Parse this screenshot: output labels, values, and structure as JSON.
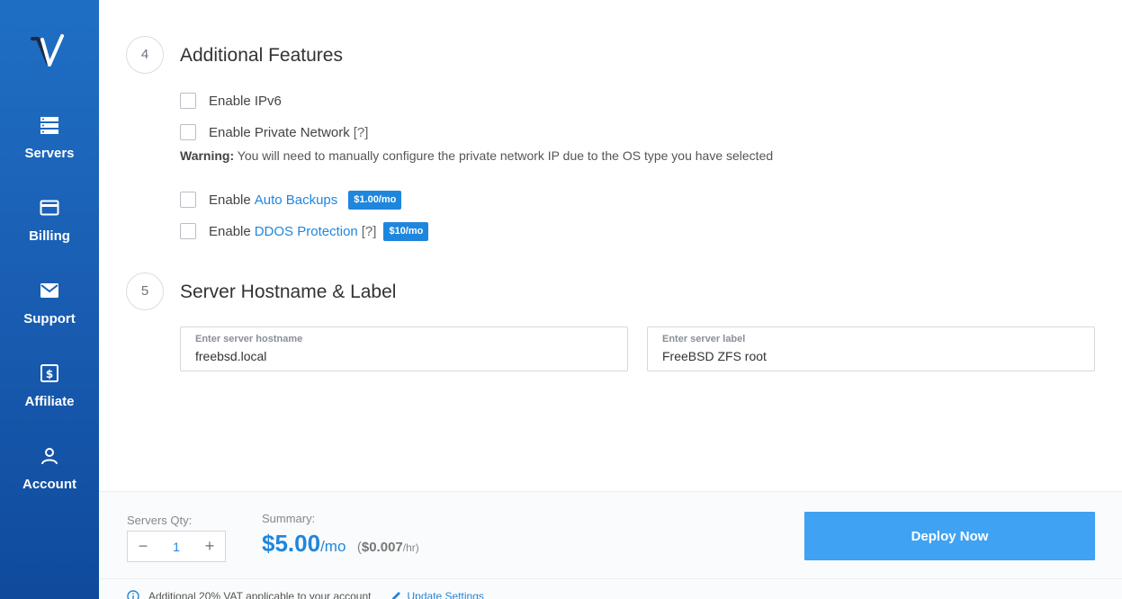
{
  "sidebar": {
    "logo_icon": "vultr-logo-icon",
    "items": [
      {
        "label": "Servers",
        "icon": "servers-icon"
      },
      {
        "label": "Billing",
        "icon": "credit-card-icon"
      },
      {
        "label": "Support",
        "icon": "envelope-icon"
      },
      {
        "label": "Affiliate",
        "icon": "dollar-icon"
      },
      {
        "label": "Account",
        "icon": "user-icon"
      }
    ]
  },
  "section4": {
    "number": "4",
    "title": "Additional Features",
    "ipv6_label": "Enable IPv6",
    "private_network_label": "Enable Private Network",
    "private_network_hint": "[?]",
    "warning_bold": "Warning:",
    "warning_text": " You will need to manually configure the private network IP due to the OS type you have selected",
    "backups_prefix": "Enable",
    "backups_link": "Auto Backups",
    "backups_price": "$1.00/mo",
    "ddos_prefix": "Enable",
    "ddos_link": "DDOS Protection",
    "ddos_hint": "[?]",
    "ddos_price": "$10/mo"
  },
  "section5": {
    "number": "5",
    "title": "Server Hostname & Label",
    "hostname_label": "Enter server hostname",
    "hostname_value": "freebsd.local",
    "label_label": "Enter server label",
    "label_value": "FreeBSD ZFS root"
  },
  "footer": {
    "qty_label": "Servers Qty:",
    "qty_minus": "−",
    "qty_value": "1",
    "qty_plus": "+",
    "summary_label": "Summary:",
    "price": "$5.00",
    "price_per": "/mo",
    "hourly_open": "(",
    "hourly_price": "$0.007",
    "hourly_per": "/hr)",
    "deploy_label": "Deploy Now",
    "vat_text": "Additional 20% VAT applicable to your account",
    "update_link": "Update Settings"
  },
  "colors": {
    "accent": "#1f86dd",
    "deploy": "#3fa2f3",
    "sidebar": "#1a5fb4"
  }
}
